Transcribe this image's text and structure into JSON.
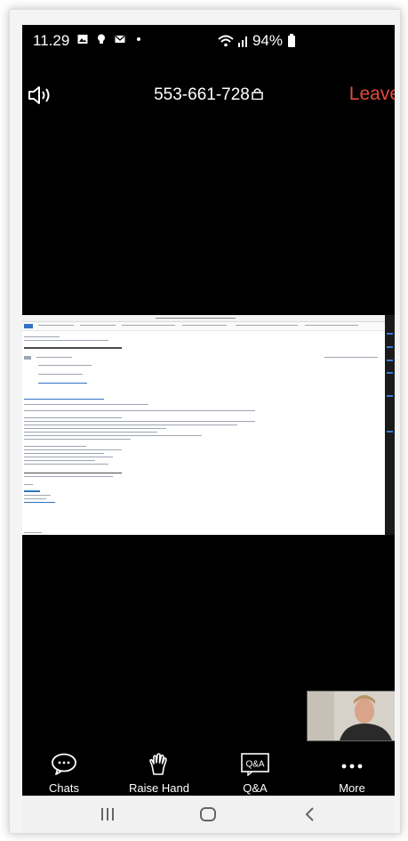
{
  "status_bar": {
    "time": "11.29",
    "left_icons": [
      "image-icon",
      "bulb-icon",
      "mail-icon",
      "dot-icon"
    ],
    "right_icons": [
      "wifi-icon",
      "signal-icon",
      "battery-icon"
    ],
    "battery": "94%"
  },
  "meeting": {
    "speaker_icon": "speaker-icon",
    "meeting_id": "553-661-728",
    "lock_icon": "lock-icon",
    "leave_label": "Leave"
  },
  "shared_screen": {
    "content": "shared-email-document",
    "side_panel": "side-taskbar"
  },
  "self_view": {
    "content": "self-video-person"
  },
  "toolbar": {
    "items": [
      {
        "label": "Chats",
        "icon": "chat-bubble-icon"
      },
      {
        "label": "Raise Hand",
        "icon": "raise-hand-icon"
      },
      {
        "label": "Q&A",
        "icon": "qa-icon",
        "icon_text": "Q&A"
      },
      {
        "label": "More",
        "icon": "more-dots-icon"
      }
    ]
  },
  "nav_bar": {
    "items": [
      "recent-apps-icon",
      "home-icon",
      "back-icon"
    ]
  },
  "colors": {
    "leave": "#e24a3b",
    "background": "#000000",
    "nav_bar": "#f1f1f1"
  }
}
